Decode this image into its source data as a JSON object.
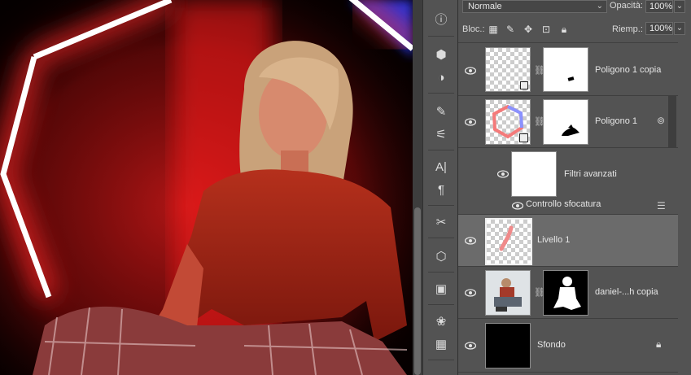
{
  "canvas": {
    "colors": {
      "background": "#000000",
      "glow_red": "#ff2a2a",
      "glow_blue": "#3a4dff",
      "frame": "#ffffff"
    }
  },
  "tools": [
    {
      "name": "info-icon",
      "glyph": "ⓘ"
    },
    {
      "name": "3d-cube-icon",
      "glyph": "⬢"
    },
    {
      "name": "adjustments-icon",
      "glyph": "◑"
    },
    {
      "name": "brush-presets-icon",
      "glyph": "✎"
    },
    {
      "name": "brush-settings-icon",
      "glyph": "⚟"
    },
    {
      "name": "character-icon",
      "glyph": "A|"
    },
    {
      "name": "paragraph-icon",
      "glyph": "¶"
    },
    {
      "name": "tool-presets-icon",
      "glyph": "✂"
    },
    {
      "name": "3d-object-icon",
      "glyph": "⬡"
    },
    {
      "name": "navigator-icon",
      "glyph": "▣"
    },
    {
      "name": "swatches-icon",
      "glyph": "❀"
    },
    {
      "name": "grid-icon",
      "glyph": "▦"
    }
  ],
  "panel": {
    "blend_mode": "Normale",
    "opacity_label": "Opacità:",
    "opacity_value": "100%",
    "lock_label": "Bloc.:",
    "fill_label": "Riemp.:",
    "fill_value": "100%"
  },
  "layers": [
    {
      "name": "Poligono 1 copia",
      "selected": false
    },
    {
      "name": "Poligono 1",
      "selected": false
    },
    {
      "name": "Filtri avanzati",
      "selected": false
    },
    {
      "name": "Controllo sfocatura",
      "selected": false
    },
    {
      "name": "Livello 1",
      "selected": true
    },
    {
      "name": "daniel-...h copia",
      "selected": false
    },
    {
      "name": "Sfondo",
      "selected": false
    }
  ]
}
